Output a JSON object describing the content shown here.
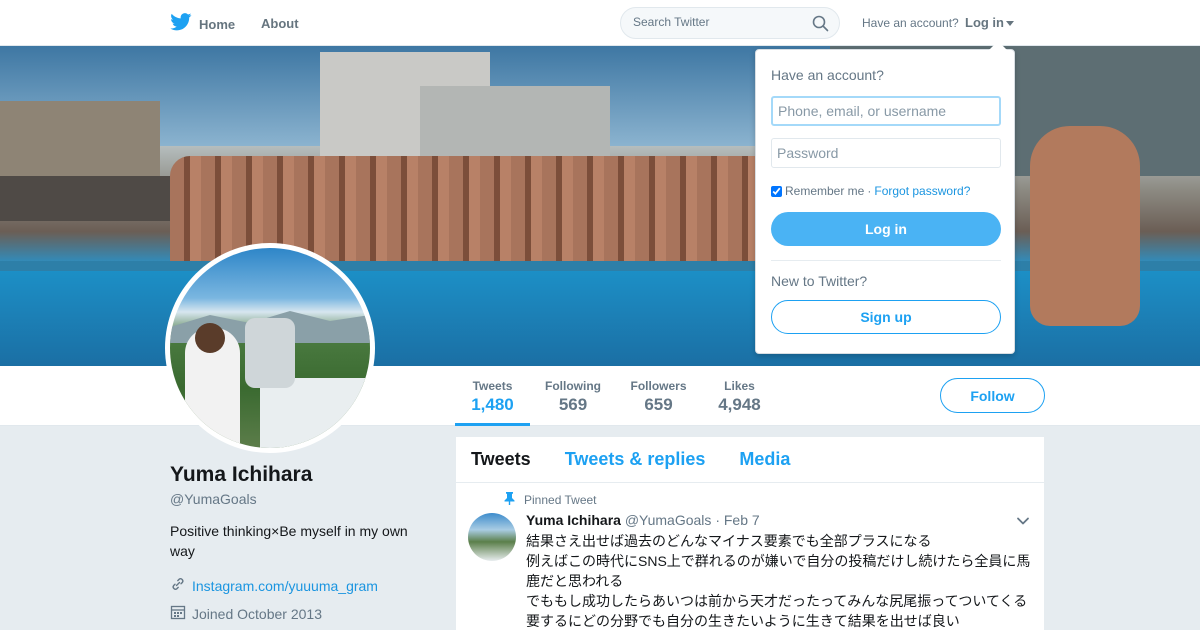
{
  "nav": {
    "home_label": "Home",
    "about_label": "About",
    "search_placeholder": "Search Twitter",
    "have_account": "Have an account?",
    "login_label": "Log in"
  },
  "profile": {
    "name": "Yuma Ichihara",
    "handle": "@YumaGoals",
    "bio": "Positive thinking×Be myself in my own way",
    "link": "Instagram.com/yuuuma_gram",
    "joined": "Joined October 2013",
    "follow_label": "Follow"
  },
  "stats": [
    {
      "label": "Tweets",
      "value": "1,480",
      "active": true
    },
    {
      "label": "Following",
      "value": "569",
      "active": false
    },
    {
      "label": "Followers",
      "value": "659",
      "active": false
    },
    {
      "label": "Likes",
      "value": "4,948",
      "active": false
    }
  ],
  "timeline": {
    "tabs": [
      "Tweets",
      "Tweets & replies",
      "Media"
    ],
    "pinned_label": "Pinned Tweet",
    "tweet": {
      "name": "Yuma Ichihara",
      "handle": "@YumaGoals",
      "separator": "·",
      "date": "Feb 7",
      "lines": [
        "結果さえ出せば過去のどんなマイナス要素でも全部プラスになる",
        "例えばこの時代にSNS上で群れるのが嫌いで自分の投稿だけし続けたら全員に馬",
        "鹿だと思われる",
        "でももし成功したらあいつは前から天才だったってみんな尻尾振ってついてくる",
        "要するにどの分野でも自分の生きたいように生きて結果を出せば良い"
      ]
    }
  },
  "login_dropdown": {
    "title": "Have an account?",
    "username_placeholder": "Phone, email, or username",
    "password_placeholder": "Password",
    "remember_label": "Remember me",
    "separator": "·",
    "forgot_label": "Forgot password?",
    "login_button": "Log in",
    "new_label": "New to Twitter?",
    "signup_button": "Sign up"
  },
  "colors": {
    "accent": "#1da1f2",
    "login_button": "#4ab3f4",
    "page_bg": "#e6ecf0",
    "muted_text": "#657786"
  },
  "icons": [
    "twitter-bird-icon",
    "search-icon",
    "caret-down-icon",
    "pin-icon",
    "link-icon",
    "calendar-icon",
    "chevron-down-icon"
  ]
}
